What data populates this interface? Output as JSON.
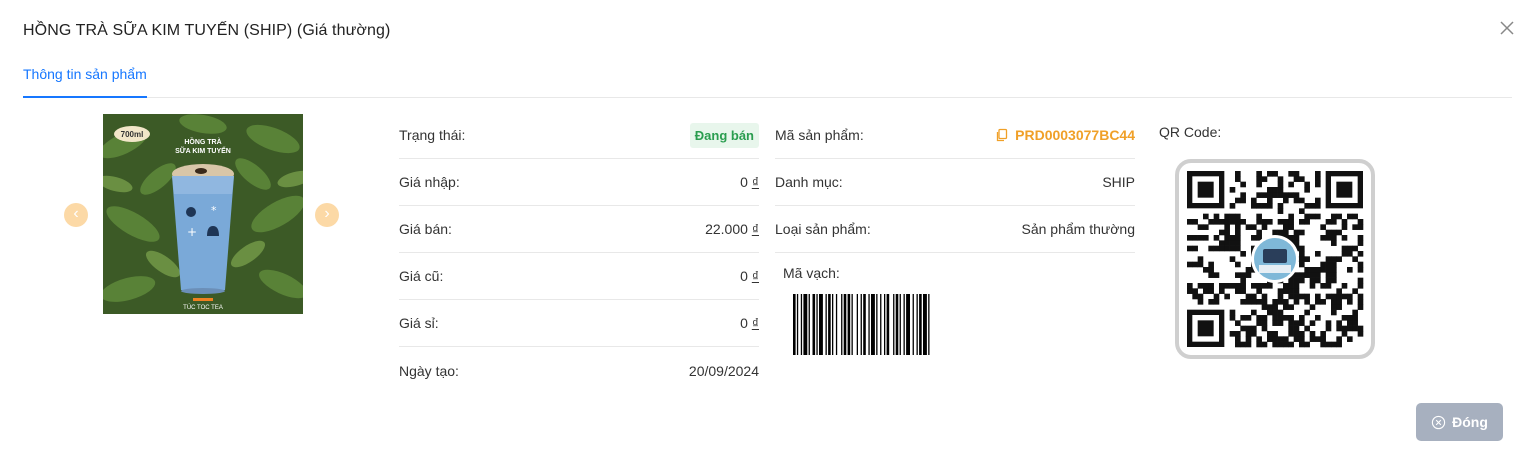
{
  "modal": {
    "title": "HỒNG TRÀ SỮA KIM TUYẾN (SHIP) (Giá thường)",
    "tab": "Thông tin sản phẩm",
    "close_button": "Đóng"
  },
  "product_image": {
    "size_tag": "700ml",
    "caption_line1": "HỒNG TRÀ",
    "caption_line2": "SỮA KIM TUYẾN",
    "brand": "TÚC TOC TEA"
  },
  "info_left": [
    {
      "label": "Trạng thái:",
      "value": "Đang bán"
    },
    {
      "label": "Giá nhập:",
      "value": "0",
      "currency": "₫"
    },
    {
      "label": "Giá bán:",
      "value": "22.000",
      "currency": "₫"
    },
    {
      "label": "Giá cũ:",
      "value": "0",
      "currency": "₫"
    },
    {
      "label": "Giá sỉ:",
      "value": "0",
      "currency": "₫"
    },
    {
      "label": "Ngày tạo:",
      "value": "20/09/2024"
    }
  ],
  "info_right": [
    {
      "label": "Mã sản phẩm:",
      "value": "PRD0003077BC44"
    },
    {
      "label": "Danh mục:",
      "value": "SHIP"
    },
    {
      "label": "Loại sản phẩm:",
      "value": "Sản phẩm thường"
    }
  ],
  "barcode_label": "Mã vạch:",
  "qr_label": "QR Code:",
  "colors": {
    "accent": "#1677ff",
    "status_green": "#2a9d4f",
    "code_orange": "#f0a028",
    "close_button_bg": "#a7b0bf"
  }
}
